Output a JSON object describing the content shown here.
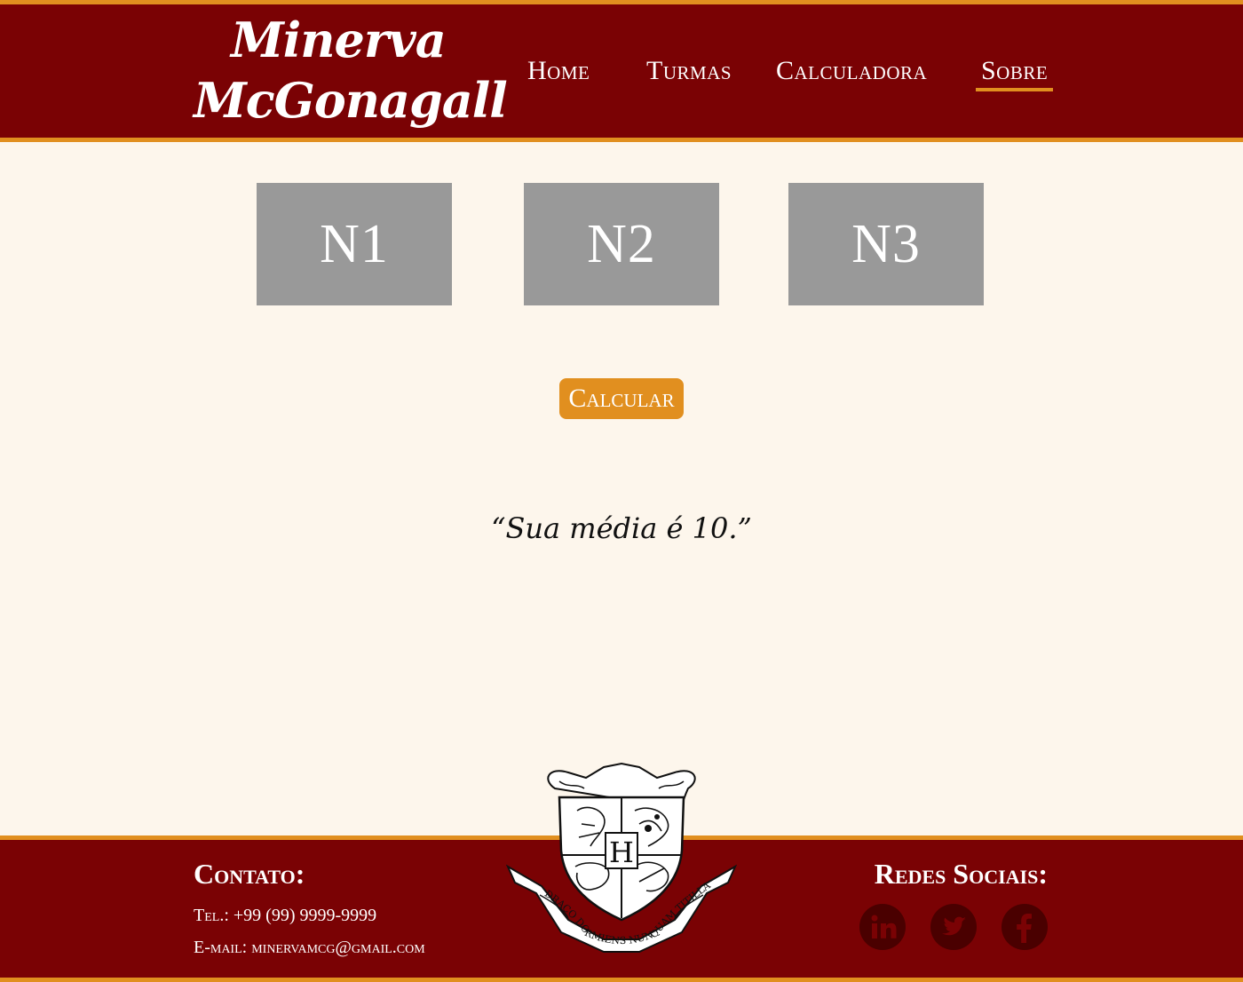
{
  "header": {
    "logo_line1": "Minerva",
    "logo_line2": "McGonagall",
    "nav": [
      {
        "label": "Home"
      },
      {
        "label": "Turmas"
      },
      {
        "label": "Calculadora"
      },
      {
        "label": "Sobre"
      }
    ],
    "active_nav": "Sobre"
  },
  "main": {
    "grades": [
      {
        "placeholder": "N1"
      },
      {
        "placeholder": "N2"
      },
      {
        "placeholder": "N3"
      }
    ],
    "calculate_label": "Calcular",
    "result_text": "“Sua média é 10.”"
  },
  "footer": {
    "contact_title": "Contato:",
    "phone": "Tel.: +99 (99) 9999-9999",
    "email": "E-mail: minervamcg@gmail.com",
    "social_title": "Redes Sociais:",
    "crest_motto": "DRACO DORMIENS NUNQUAM TITILLANDUS",
    "social": [
      {
        "icon": "linkedin-icon",
        "glyph": "in"
      },
      {
        "icon": "twitter-icon",
        "glyph": "t"
      },
      {
        "icon": "facebook-icon",
        "glyph": "f"
      }
    ]
  },
  "colors": {
    "primary": "#7a0204",
    "accent": "#e18f1f",
    "background": "#fdf6ec",
    "input_box": "#999999"
  }
}
